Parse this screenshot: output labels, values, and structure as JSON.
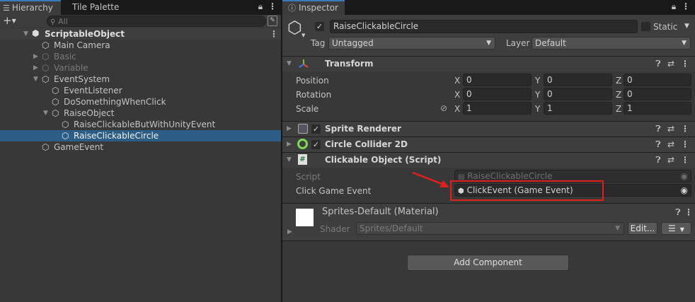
{
  "hierarchy": {
    "tabs": [
      {
        "label": "Hierarchy"
      },
      {
        "label": "Tile Palette"
      }
    ],
    "search_placeholder": "All",
    "scene_name": "ScriptableObject",
    "items": [
      {
        "label": "Main Camera"
      },
      {
        "label": "Basic"
      },
      {
        "label": "Variable"
      },
      {
        "label": "EventSystem"
      },
      {
        "label": "EventListener"
      },
      {
        "label": "DoSomethingWhenClick"
      },
      {
        "label": "RaiseObject"
      },
      {
        "label": "RaiseClickableButWithUnityEvent"
      },
      {
        "label": "RaiseClickableCircle"
      },
      {
        "label": "GameEvent"
      }
    ]
  },
  "inspector": {
    "tab_label": "Inspector",
    "object_name": "RaiseClickableCircle",
    "static_label": "Static",
    "tag_label": "Tag",
    "tag_value": "Untagged",
    "layer_label": "Layer",
    "layer_value": "Default",
    "transform": {
      "title": "Transform",
      "rows": [
        {
          "label": "Position",
          "x": "0",
          "y": "0",
          "z": "0"
        },
        {
          "label": "Rotation",
          "x": "0",
          "y": "0",
          "z": "0"
        },
        {
          "label": "Scale",
          "x": "1",
          "y": "1",
          "z": "1"
        }
      ],
      "axis_x": "X",
      "axis_y": "Y",
      "axis_z": "Z"
    },
    "sprite_renderer": {
      "title": "Sprite Renderer"
    },
    "circle_collider": {
      "title": "Circle Collider 2D"
    },
    "clickable": {
      "title": "Clickable Object (Script)",
      "script_label": "Script",
      "script_value": "RaiseClickableCircle",
      "event_label": "Click Game Event",
      "event_value": "ClickEvent (Game Event)"
    },
    "material": {
      "title": "Sprites-Default (Material)",
      "shader_label": "Shader",
      "shader_value": "Sprites/Default",
      "edit_label": "Edit..."
    },
    "add_component_label": "Add Component"
  },
  "colors": {
    "highlight": "#e0201c",
    "selection": "#2c5d87",
    "accent": "#3a79bb"
  }
}
